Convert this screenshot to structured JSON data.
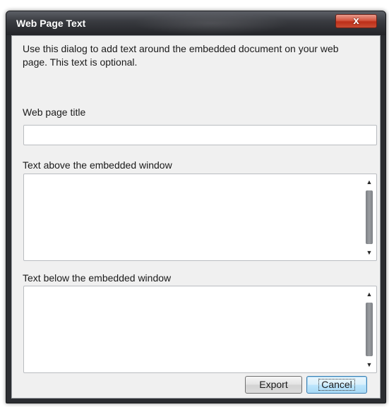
{
  "dialog": {
    "title": "Web Page Text",
    "close_label": "x",
    "intro_text": "Use this dialog to add text around the embedded document on your web page. This text is optional."
  },
  "fields": {
    "title_label": "Web page title",
    "title_value": "",
    "above_label": "Text above the embedded window",
    "above_value": "",
    "below_label": "Text below the embedded window",
    "below_value": ""
  },
  "buttons": {
    "export_label": "Export",
    "cancel_label": "Cancel"
  },
  "icons": {
    "close": "close-icon",
    "scroll_up": "arrow-up-icon",
    "scroll_down": "arrow-down-icon"
  },
  "colors": {
    "titlebar": "#2b2d31",
    "close_button": "#c94c33",
    "dialog_background": "#f0f0f0",
    "default_button_accent": "#3c7fb1"
  }
}
